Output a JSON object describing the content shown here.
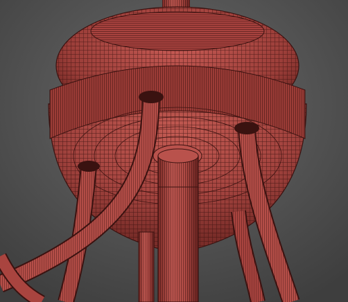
{
  "scene": {
    "background_color": "#555555",
    "mesh_fill_color": "#b04a45",
    "mesh_wire_color": "#3a1210"
  }
}
